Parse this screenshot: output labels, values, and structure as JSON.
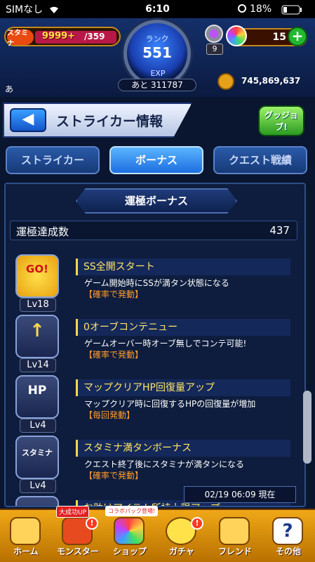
{
  "status_bar": {
    "carrier": "SIMなし",
    "time": "6:10",
    "battery": "18%"
  },
  "header": {
    "stamina_label": "スタミナ",
    "stamina_value": "9999+",
    "stamina_max": "/359",
    "rank_label": "ランク",
    "rank_value": "551",
    "exp_label": "EXP",
    "exp_remaining": "あと 311787",
    "box_count": "9",
    "orb_count": "15",
    "coins": "745,869,637",
    "chat_text": "あ"
  },
  "title_bar": {
    "title": "ストライカー情報",
    "good_job": "グッジョブ!"
  },
  "tabs": [
    {
      "label": "ストライカー"
    },
    {
      "label": "ボーナス"
    },
    {
      "label": "クエスト戦績"
    }
  ],
  "panel": {
    "heading": "運極ボーナス",
    "count_label": "運極達成数",
    "count_value": "437",
    "bonuses": [
      {
        "icon_text": "GO!",
        "level": "Lv18",
        "name": "SS全開スタート",
        "desc": "ゲーム開始時にSSが満タン状態になる",
        "cond": "【確率で発動】"
      },
      {
        "icon_text": "↑",
        "level": "Lv14",
        "name": "0オーブコンテニュー",
        "desc": "ゲームオーバー時オーブ無しでコンテ可能!",
        "cond": "【確率で発動】"
      },
      {
        "icon_text": "HP",
        "level": "Lv4",
        "name": "マップクリアHP回復量アップ",
        "desc": "マップクリア時に回復するHPの回復量が増加",
        "cond": "【毎回発動】"
      },
      {
        "icon_text": "スタミナ",
        "level": "Lv4",
        "name": "スタミナ満タンボーナス",
        "desc": "クエスト終了後にスタミナが満タンになる",
        "cond": "【確率で発動】"
      },
      {
        "icon_text": "",
        "level": "",
        "name": "お助けアイテム所持上限アップ",
        "desc": "",
        "cond": ""
      }
    ],
    "timestamp": "02/19 06:09 現在"
  },
  "bottom_nav": [
    {
      "label": "ホーム",
      "badge": ""
    },
    {
      "label": "モンスター",
      "badge": "大成功UP"
    },
    {
      "label": "ショップ",
      "badge": "コラボパック登場!"
    },
    {
      "label": "ガチャ",
      "badge": ""
    },
    {
      "label": "フレンド",
      "badge": ""
    },
    {
      "label": "その他",
      "badge": ""
    }
  ],
  "colors": {
    "accent": "#1d6ee0",
    "highlight": "#ffe566",
    "condition": "#ff9b2a",
    "nav": "#f0a818"
  }
}
